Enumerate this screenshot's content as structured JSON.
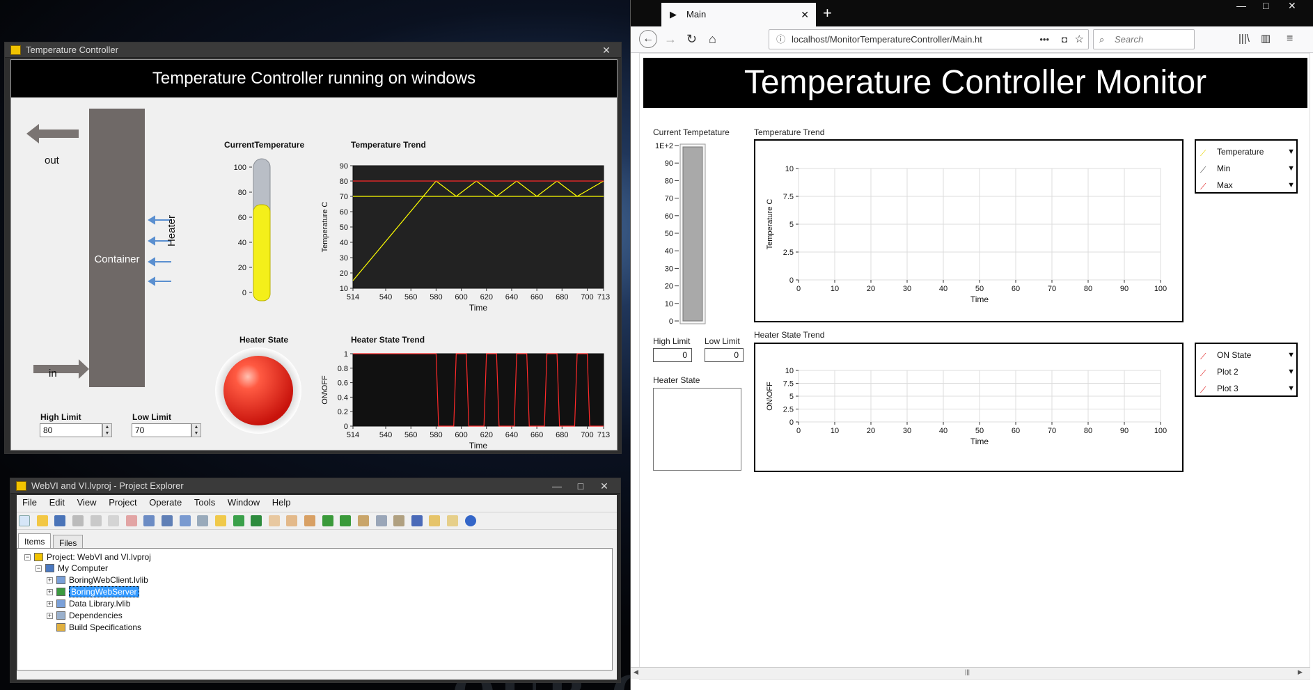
{
  "desktop": {
    "background_text": "OUR CHOOSING"
  },
  "tc_window": {
    "title": "Temperature Controller",
    "heading": "Temperature Controller running on windows",
    "out_label": "out",
    "in_label": "in",
    "container_label": "Container",
    "heater_label": "Heater",
    "current_temp_label": "CurrentTemperature",
    "thermo_ticks": [
      "100",
      "80",
      "60",
      "40",
      "20",
      "0"
    ],
    "thermo_value": 70,
    "temp_trend_label": "Temperature Trend",
    "heater_state_label": "Heater State",
    "heater_trend_label": "Heater State Trend",
    "high_limit_label": "High Limit",
    "high_limit_value": "80",
    "low_limit_label": "Low Limit",
    "low_limit_value": "70"
  },
  "pe_window": {
    "title": "WebVI and VI.lvproj - Project Explorer",
    "menu": [
      "File",
      "Edit",
      "View",
      "Project",
      "Operate",
      "Tools",
      "Window",
      "Help"
    ],
    "tabs": [
      "Items",
      "Files"
    ],
    "tree": [
      {
        "label": "Project: WebVI and VI.lvproj"
      },
      {
        "label": "My Computer"
      },
      {
        "label": "BoringWebClient.lvlib"
      },
      {
        "label": "BoringWebServer"
      },
      {
        "label": "Data Library.lvlib"
      },
      {
        "label": "Dependencies"
      },
      {
        "label": "Build Specifications"
      }
    ]
  },
  "browser": {
    "tab_title": "Main",
    "url": "localhost/MonitorTemperatureController/Main.ht",
    "search_placeholder": "Search",
    "page_title": "Temperature Controller Monitor",
    "current_temp_label": "Current Tempetature",
    "thermo_ticks": [
      "1E+2",
      "90",
      "80",
      "70",
      "60",
      "50",
      "40",
      "30",
      "20",
      "10",
      "0"
    ],
    "temp_trend_label": "Temperature Trend",
    "heater_trend_label": "Heater State Trend",
    "high_limit_label": "High Limit",
    "high_limit_value": "0",
    "low_limit_label": "Low Limit",
    "low_limit_value": "0",
    "heater_state_label": "Heater State",
    "temp_legend": [
      "Temperature",
      "Min",
      "Max"
    ],
    "heater_legend": [
      "ON State",
      "Plot 2",
      "Plot 3"
    ]
  },
  "colors": {
    "temp": "#ffff00",
    "limit": "#ff2a2a",
    "led": "#e8231f",
    "thermo_fill": "#f4ef1a"
  },
  "chart_data": [
    {
      "type": "line",
      "chart_id": "tc_temp",
      "title": "",
      "xlabel": "Time",
      "ylabel": "Temperature C",
      "xlim": [
        514,
        713
      ],
      "ylim": [
        10,
        90
      ],
      "xticks": [
        514,
        540,
        560,
        580,
        600,
        620,
        640,
        660,
        680,
        700,
        713
      ],
      "yticks": [
        10,
        20,
        30,
        40,
        50,
        60,
        70,
        80,
        90
      ],
      "series": [
        {
          "name": "",
          "color": "#ffff00",
          "x": [
            514,
            580,
            596,
            612,
            628,
            644,
            660,
            676,
            692,
            713
          ],
          "y": [
            15,
            80,
            70,
            80,
            70,
            80,
            70,
            80,
            70,
            80
          ]
        },
        {
          "name": "",
          "color": "#ff2a2a",
          "x": [
            514,
            713
          ],
          "y": [
            80,
            80
          ]
        },
        {
          "name": "",
          "color": "#ffff00",
          "x": [
            514,
            713
          ],
          "y": [
            70,
            70
          ]
        }
      ]
    },
    {
      "type": "line",
      "chart_id": "tc_heater",
      "title": "",
      "xlabel": "Time",
      "ylabel": "ON\\OFF",
      "xlim": [
        514,
        713
      ],
      "ylim": [
        0,
        1
      ],
      "xticks": [
        514,
        540,
        560,
        580,
        600,
        620,
        640,
        660,
        680,
        700,
        713
      ],
      "yticks": [
        0,
        0.2,
        0.4,
        0.6,
        0.8,
        1
      ],
      "series": [
        {
          "name": "",
          "color": "#ff2a2a",
          "x": [
            514,
            580,
            582,
            594,
            596,
            604,
            606,
            618,
            620,
            628,
            630,
            642,
            644,
            652,
            654,
            666,
            668,
            676,
            678,
            690,
            692,
            700,
            702,
            713
          ],
          "y": [
            1,
            1,
            0,
            0,
            1,
            1,
            0,
            0,
            1,
            1,
            0,
            0,
            1,
            1,
            0,
            0,
            1,
            1,
            0,
            0,
            1,
            1,
            0,
            0
          ]
        }
      ]
    },
    {
      "type": "line",
      "chart_id": "web_temp",
      "title": "",
      "xlabel": "Time",
      "ylabel": "Temperature C",
      "xlim": [
        0,
        100
      ],
      "ylim": [
        0,
        10
      ],
      "xticks": [
        0,
        10,
        20,
        30,
        40,
        50,
        60,
        70,
        80,
        90,
        100
      ],
      "yticks": [
        0,
        2.5,
        5,
        7.5,
        10
      ],
      "series": []
    },
    {
      "type": "line",
      "chart_id": "web_heater",
      "title": "",
      "xlabel": "Time",
      "ylabel": "ON\\OFF",
      "xlim": [
        0,
        100
      ],
      "ylim": [
        0,
        10
      ],
      "xticks": [
        0,
        10,
        20,
        30,
        40,
        50,
        60,
        70,
        80,
        90,
        100
      ],
      "yticks": [
        0,
        2.5,
        5,
        7.5,
        10
      ],
      "series": []
    }
  ]
}
